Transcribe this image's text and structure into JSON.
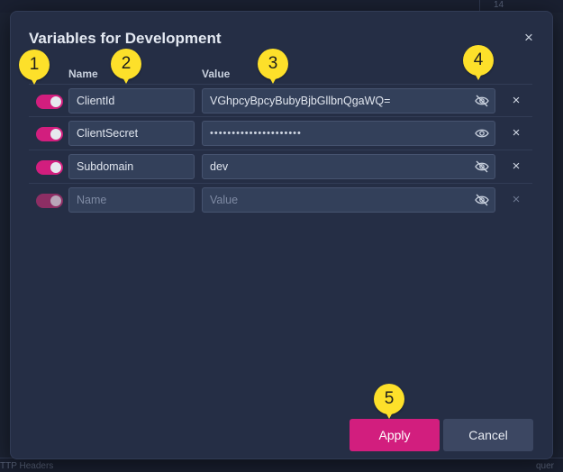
{
  "background": {
    "top_number": "14",
    "bottom_left_text": "TTP Headers",
    "bottom_right_text": "quer"
  },
  "dialog": {
    "title": "Variables for Development",
    "close_glyph": "×"
  },
  "columns": {
    "name": "Name",
    "value": "Value"
  },
  "variables": [
    {
      "enabled": true,
      "name": "ClientId",
      "value": "VGhpcyBpcyBubyBjbGllbnQgaWQ=",
      "masked": false,
      "visibility_icon": "eye-off-icon"
    },
    {
      "enabled": true,
      "name": "ClientSecret",
      "value": "•••••••••••••••••••••",
      "masked": true,
      "visibility_icon": "eye-icon"
    },
    {
      "enabled": true,
      "name": "Subdomain",
      "value": "dev",
      "masked": false,
      "visibility_icon": "eye-off-icon"
    }
  ],
  "new_row": {
    "name_placeholder": "Name",
    "value_placeholder": "Value",
    "visibility_icon": "eye-off-icon"
  },
  "row_remove_glyph": "×",
  "buttons": {
    "apply": "Apply",
    "cancel": "Cancel"
  },
  "callouts": [
    "1",
    "2",
    "3",
    "4",
    "5"
  ],
  "colors": {
    "accent": "#d21e7e",
    "callout": "#fde02a",
    "dialog_bg": "#252e45",
    "field_bg": "#33405a"
  }
}
